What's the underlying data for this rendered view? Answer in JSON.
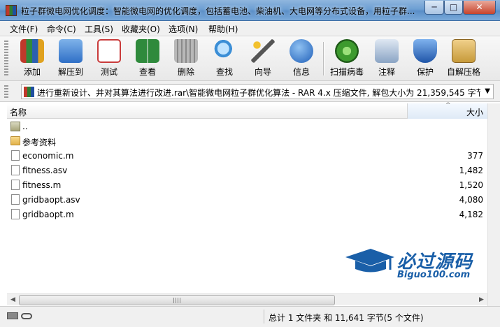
{
  "window": {
    "title": "粒子群微电网优化调度：智能微电网的优化调度，包括蓄电池、柴油机、大电网等分布式设备，用粒子群...",
    "minimize_glyph": "─",
    "maximize_glyph": "□",
    "close_glyph": "✕"
  },
  "menu": [
    {
      "label": "文件(F)"
    },
    {
      "label": "命令(C)"
    },
    {
      "label": "工具(S)"
    },
    {
      "label": "收藏夹(O)"
    },
    {
      "label": "选项(N)"
    },
    {
      "label": "帮助(H)"
    }
  ],
  "toolbar": [
    {
      "label": "添加",
      "icon": "books-add-icon",
      "color": "#c0392b"
    },
    {
      "label": "解压到",
      "icon": "folder-extract-icon",
      "color": "#3a79c7"
    },
    {
      "label": "测试",
      "icon": "checklist-icon",
      "color": "#d64242"
    },
    {
      "label": "查看",
      "icon": "book-view-icon",
      "color": "#2f8a3c"
    },
    {
      "label": "删除",
      "icon": "trash-icon",
      "color": "#8e8e8e"
    },
    {
      "label": "查找",
      "icon": "magnifier-icon",
      "color": "#3b8ed6"
    },
    {
      "label": "向导",
      "icon": "wand-icon",
      "color": "#6c63c9"
    },
    {
      "label": "信息",
      "icon": "info-icon",
      "color": "#2f6fc6"
    },
    {
      "label": "扫描病毒",
      "icon": "virus-scan-icon",
      "color": "#3d9a2e"
    },
    {
      "label": "注释",
      "icon": "comment-icon",
      "color": "#6f8fb3"
    },
    {
      "label": "保护",
      "icon": "shield-icon",
      "color": "#2c67c0"
    },
    {
      "label": "自解压格",
      "icon": "sfx-box-icon",
      "color": "#c79a3a"
    }
  ],
  "address": {
    "path": "进行重新设计、并对其算法进行改进.rar\\智能微电网粒子群优化算法 - RAR 4.x 压缩文件, 解包大小为 21,359,545 字节"
  },
  "columns": {
    "name": "名称",
    "size": "大小",
    "sort_glyph": "^"
  },
  "files": [
    {
      "name": "..",
      "size": "",
      "type": "up"
    },
    {
      "name": "参考资料",
      "size": "",
      "type": "folder"
    },
    {
      "name": "economic.m",
      "size": "377",
      "type": "file"
    },
    {
      "name": "fitness.asv",
      "size": "1,482",
      "type": "file"
    },
    {
      "name": "fitness.m",
      "size": "1,520",
      "type": "file"
    },
    {
      "name": "gridbaopt.asv",
      "size": "4,080",
      "type": "file"
    },
    {
      "name": "gridbaopt.m",
      "size": "4,182",
      "type": "file"
    }
  ],
  "scrollbar": {
    "left_glyph": "◀",
    "right_glyph": "▶"
  },
  "status": {
    "summary": "总计 1 文件夹 和 11,641 字节(5 个文件)"
  },
  "watermark": {
    "title": "必过源码",
    "subtitle": "Biguo100.com"
  }
}
